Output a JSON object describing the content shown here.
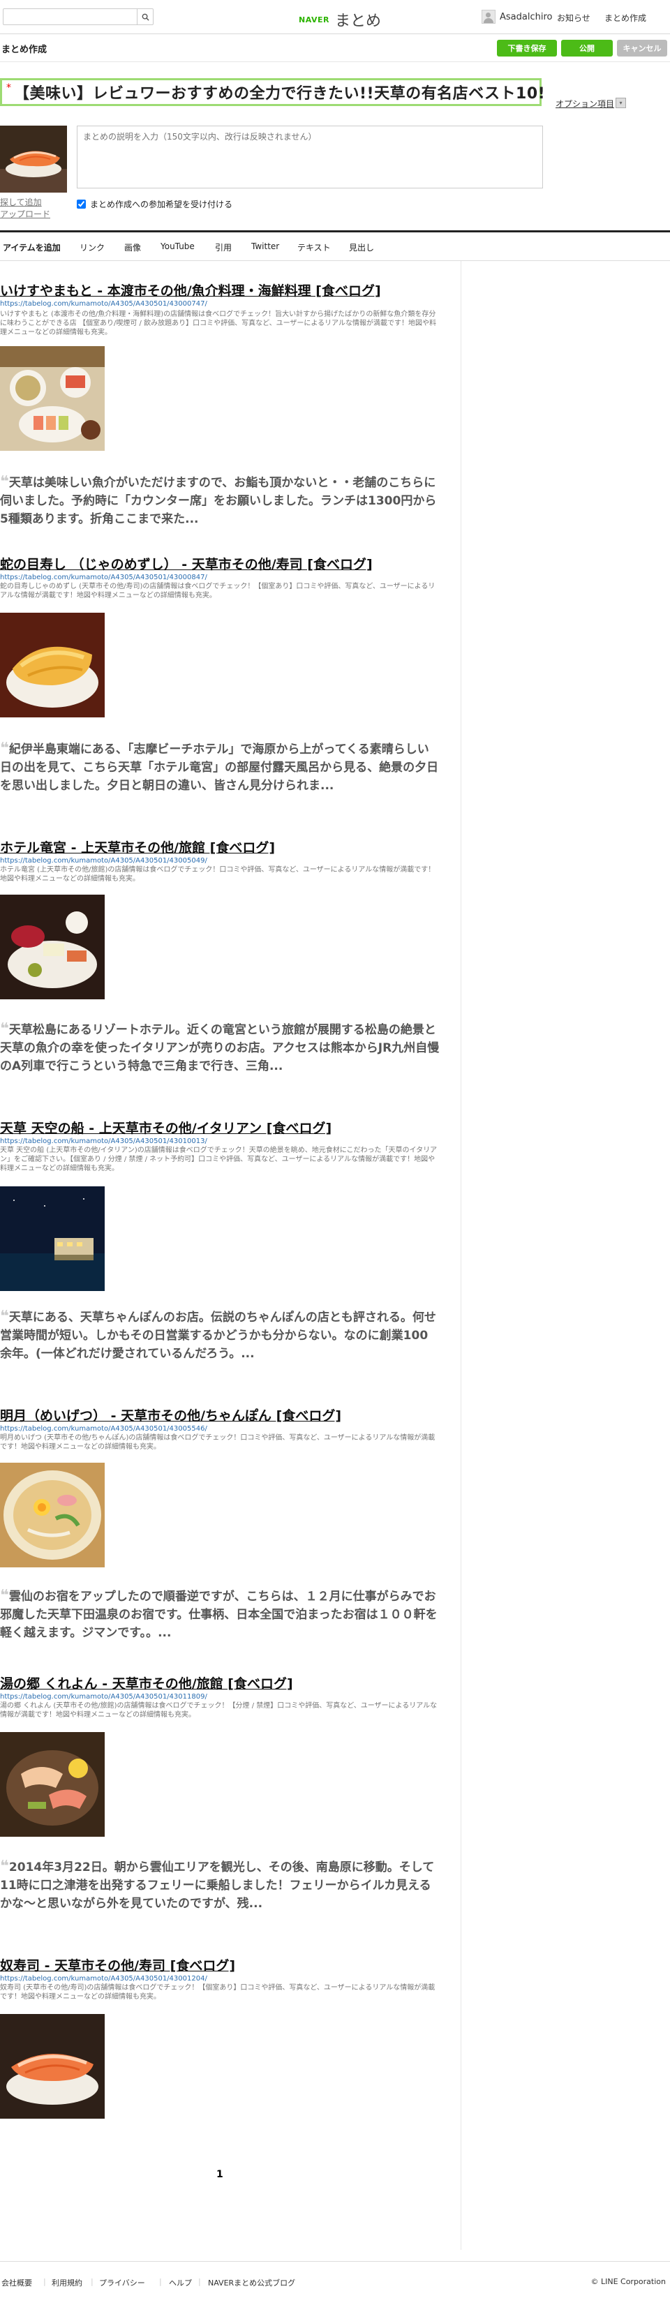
{
  "header": {
    "search_placeholder": "",
    "brand_naver": "NAVER",
    "brand_name": "まとめ",
    "username": "Asadalchiro",
    "nav": [
      "お知らせ",
      "まとめ作成"
    ]
  },
  "subheader": {
    "title": "まとめ作成",
    "buttons": {
      "draft": "下書き保存",
      "publish": "公開",
      "cancel": "キャンセル"
    }
  },
  "editor": {
    "required_mark": "*",
    "title": "【美味い】レビュワーおすすめの全力で行きたい!!天草の有名店ベスト10!",
    "option_link": "オプション項目",
    "thumb_links": [
      "探して追加",
      "アップロード"
    ],
    "description_placeholder": "まとめの説明を入力（150文字以内、改行は反映されません）",
    "participation_label": "まとめ作成への参加希望を受け付ける",
    "participation_checked": true
  },
  "toolbar": {
    "items": [
      "アイテムを追加",
      "リンク",
      "画像",
      "YouTube",
      "引用",
      "Twitter",
      "テキスト",
      "見出し"
    ]
  },
  "sections": [
    {
      "title": "いけすやまもと - 本渡市その他/魚介料理・海鮮料理 [食べログ]",
      "url": "https://tabelog.com/kumamoto/A4305/A430501/43000747/",
      "desc": "いけすやまもと (本渡市その他/魚介料理・海鮮料理)の店舗情報は食べログでチェック！旨大い計すから揚げたばかりの新鮮な魚介類を存分に味わうことができる店 【個室あり/喫煙可 / 飲み放題あり】口コミや評価、写真など、ユーザーによるリアルな情報が満載です！地図や料理メニューなどの詳細情報も充実。",
      "quote": "天草は美味しい魚介がいただけますので、お鮨も頂かないと・・老舗のこちらに伺いました。予約時に「カウンター席」をお願いしました。ランチは1300円から5種類あります。折角ここまで来た..."
    },
    {
      "title": "蛇の目寿し （じゃのめずし） - 天草市その他/寿司 [食べログ]",
      "url": "https://tabelog.com/kumamoto/A4305/A430501/43000847/",
      "desc": "蛇の目寿しじゃのめずし (天草市その他/寿司)の店舗情報は食べログでチェック！【個室あり】口コミや評価、写真など、ユーザーによるリアルな情報が満載です！地図や料理メニューなどの詳細情報も充実。",
      "quote": "紀伊半島東端にある、「志摩ビーチホテル」で海原から上がってくる素晴らしい日の出を見て、こちら天草「ホテル竜宮」の部屋付露天風呂から見る、絶景の夕日を思い出しました。夕日と朝日の違い、皆さん見分けられま..."
    },
    {
      "title": "ホテル竜宮 - 上天草市その他/旅館 [食べログ]",
      "url": "https://tabelog.com/kumamoto/A4305/A430501/43005049/",
      "desc": "ホテル竜宮 (上天草市その他/旅館)の店舗情報は食べログでチェック！口コミや評価、写真など、ユーザーによるリアルな情報が満載です！地図や料理メニューなどの詳細情報も充実。",
      "quote": "天草松島にあるリゾートホテル。近くの竜宮という旅館が展開する松島の絶景と天草の魚介の幸を使ったイタリアンが売りのお店。アクセスは熊本からJR九州自慢のA列車で行こうという特急で三角まで行き、三角..."
    },
    {
      "title": "天草 天空の船 - 上天草市その他/イタリアン [食べログ]",
      "url": "https://tabelog.com/kumamoto/A4305/A430501/43010013/",
      "desc": "天草 天空の船 (上天草市その他/イタリアン)の店舗情報は食べログでチェック！天草の絶景を眺め、地元食材にこだわった「天草のイタリアン」をご確認下さい。【個室あり / 分煙 / 禁煙 / ネット予約可】口コミや評価、写真など、ユーザーによるリアルな情報が満載です！地図や料理メニューなどの詳細情報も充実。",
      "quote": "天草にある、天草ちゃんぽんのお店。伝説のちゃんぽんの店とも評される。何せ営業時間が短い。しかもその日営業するかどうかも分からない。なのに創業100余年。(一体どれだけ愛されているんだろう。..."
    },
    {
      "title": "明月（めいげつ） - 天草市その他/ちゃんぽん [食べログ]",
      "url": "https://tabelog.com/kumamoto/A4305/A430501/43005546/",
      "desc": "明月めいげつ (天草市その他/ちゃんぽん)の店舗情報は食べログでチェック！口コミや評価、写真など、ユーザーによるリアルな情報が満載です！地図や料理メニューなどの詳細情報も充実。",
      "quote": "雲仙のお宿をアップしたので順番逆ですが、こちらは、１２月に仕事がらみでお邪魔した天草下田温泉のお宿です。仕事柄、日本全国で泊まったお宿は１００軒を軽く越えます。ジマンです。。..."
    },
    {
      "title": "湯の郷 くれよん - 天草市その他/旅館 [食べログ]",
      "url": "https://tabelog.com/kumamoto/A4305/A430501/43011809/",
      "desc": "湯の郷 くれよん (天草市その他/旅館)の店舗情報は食べログでチェック！【分煙 / 禁煙】口コミや評価、写真など、ユーザーによるリアルな情報が満載です！地図や料理メニューなどの詳細情報も充実。",
      "quote": "2014年3月22日。朝から雲仙エリアを観光し、その後、南島原に移動。そして11時に口之津港を出発するフェリーに乗船しました！フェリーからイルカ見えるかな〜と思いながら外を見ていたのですが、残..."
    },
    {
      "title": "奴寿司 - 天草市その他/寿司 [食べログ]",
      "url": "https://tabelog.com/kumamoto/A4305/A430501/43001204/",
      "desc": "奴寿司 (天草市その他/寿司)の店舗情報は食べログでチェック！【個室あり】口コミや評価、写真など、ユーザーによるリアルな情報が満載です！地図や料理メニューなどの詳細情報も充実。",
      "quote": ""
    }
  ],
  "pagination": {
    "current": "1"
  },
  "footer": {
    "links": [
      "会社概要",
      "利用規約",
      "プライバシー",
      "ヘルプ",
      "NAVERまとめ公式ブログ"
    ],
    "copyright": "© LINE Corporation"
  },
  "colors": {
    "green": "#2db400",
    "button_green": "#4cbb17",
    "cancel_gray": "#bbbbbb",
    "url_blue": "#2a6db0",
    "title_border": "#9ddb73"
  }
}
